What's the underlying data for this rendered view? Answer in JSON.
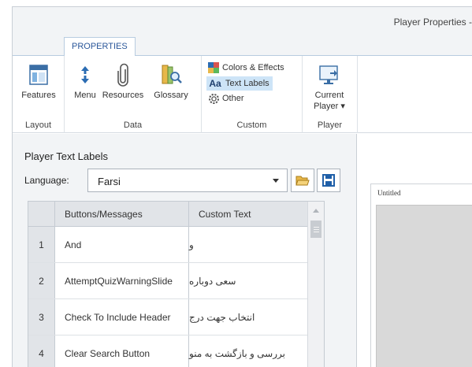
{
  "window": {
    "title": "Player Properties -"
  },
  "ribbon": {
    "tab": "PROPERTIES",
    "groups": {
      "layout": {
        "label": "Layout",
        "features": "Features"
      },
      "data": {
        "label": "Data",
        "menu": "Menu",
        "resources": "Resources",
        "glossary": "Glossary"
      },
      "custom": {
        "label": "Custom",
        "colors": "Colors & Effects",
        "text_labels": "Text Labels",
        "other": "Other"
      },
      "player": {
        "label": "Player",
        "current_line1": "Current",
        "current_line2": "Player ▾"
      }
    }
  },
  "panel": {
    "title": "Player Text Labels",
    "language_label": "Language:",
    "language_value": "Farsi"
  },
  "table": {
    "columns": [
      "Buttons/Messages",
      "Custom Text"
    ],
    "rows": [
      {
        "num": "1",
        "message": "And",
        "custom": "و"
      },
      {
        "num": "2",
        "message": "AttemptQuizWarningSlide",
        "custom": "سعی دوباره"
      },
      {
        "num": "3",
        "message": "Check To Include Header",
        "custom": "انتخاب جهت درج"
      },
      {
        "num": "4",
        "message": "Clear Search Button",
        "custom": "بررسی و بازگشت به منو"
      }
    ]
  },
  "preview": {
    "title": "Untitled"
  },
  "colors": {
    "accent": "#2b579a",
    "selected": "#cde4f7",
    "header_bg": "#e1e4e8"
  }
}
